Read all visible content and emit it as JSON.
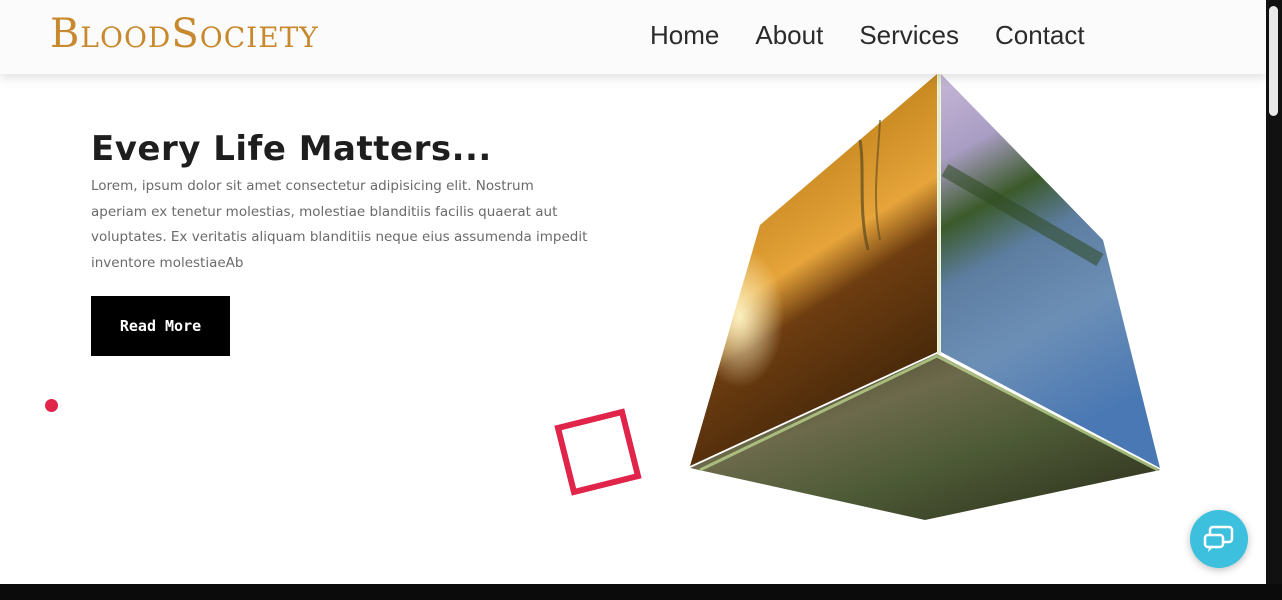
{
  "brand": {
    "logo_text": "BloodSociety",
    "color": "#c8892e"
  },
  "nav": {
    "items": [
      {
        "label": "Home"
      },
      {
        "label": "About"
      },
      {
        "label": "Services"
      },
      {
        "label": "Contact"
      }
    ]
  },
  "hero": {
    "title": "Every Life Matters...",
    "body": "Lorem, ipsum dolor sit amet consectetur adipisicing elit. Nostrum aperiam ex tenetur molestias, molestiae blanditiis facilis quaerat aut voluptates. Ex veritatis aliquam blanditiis neque eius assumenda impedit inventore molestiaeAb",
    "button_label": "Read More"
  },
  "decorations": {
    "accent_color": "#e0244a"
  },
  "chat": {
    "icon": "chat-bubbles-icon",
    "color": "#3cc0de"
  },
  "cube": {
    "faces": [
      "sunset-landscape-image",
      "lake-landscape-image",
      "bottom-landscape-image"
    ]
  }
}
